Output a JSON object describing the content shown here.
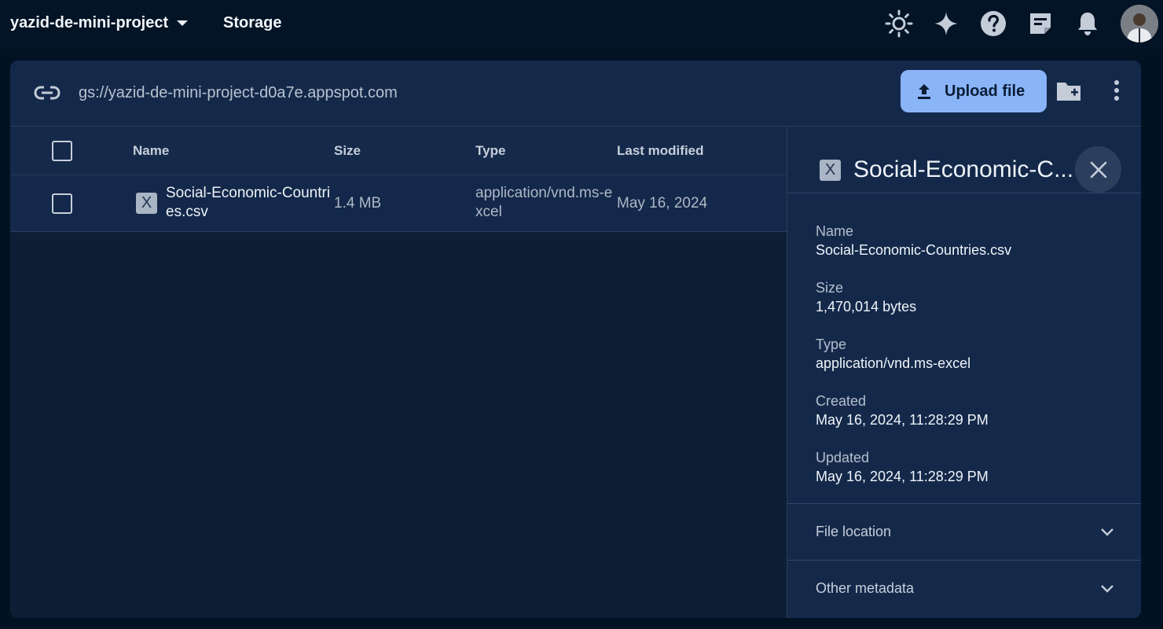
{
  "topbar": {
    "project_name": "yazid-de-mini-project",
    "section_title": "Storage",
    "icons": [
      "brightness-icon",
      "sparkle-icon",
      "help-icon",
      "feedback-icon",
      "notifications-icon",
      "avatar"
    ]
  },
  "bucket": {
    "path": "gs://yazid-de-mini-project-d0a7e.appspot.com",
    "upload_label": "Upload file"
  },
  "table": {
    "columns": [
      "Name",
      "Size",
      "Type",
      "Last modified"
    ],
    "rows": [
      {
        "name": "Social-Economic-Countries.csv",
        "size": "1.4 MB",
        "type": "application/vnd.ms-excel",
        "last_modified": "May 16, 2024"
      }
    ]
  },
  "details": {
    "title": "Social-Economic-C...",
    "file_icon_letter": "X",
    "properties": [
      {
        "label": "Name",
        "value": "Social-Economic-Countries.csv"
      },
      {
        "label": "Size",
        "value": "1,470,014 bytes"
      },
      {
        "label": "Type",
        "value": "application/vnd.ms-excel"
      },
      {
        "label": "Created",
        "value": "May 16, 2024, 11:28:29 PM"
      },
      {
        "label": "Updated",
        "value": "May 16, 2024, 11:28:29 PM"
      }
    ],
    "sections": [
      "File location",
      "Other metadata"
    ]
  },
  "colors": {
    "accent": "#8ab4f8",
    "background": "#011222",
    "panel": "#14294a"
  }
}
